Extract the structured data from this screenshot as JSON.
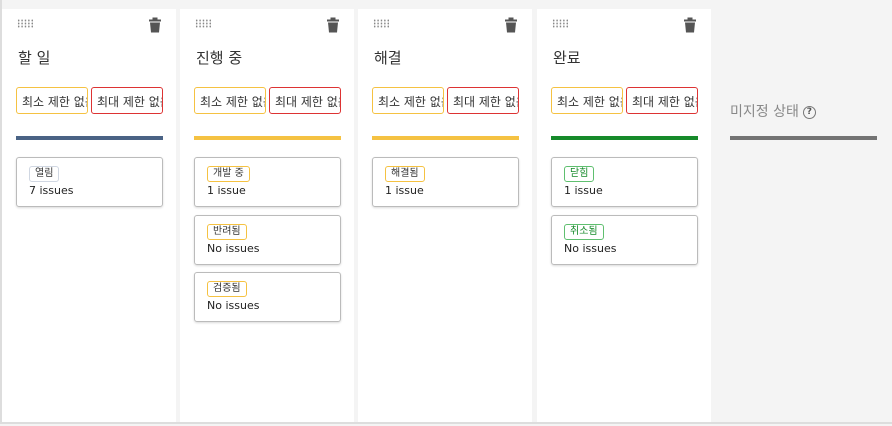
{
  "columns": [
    {
      "title": "할 일",
      "min_label": "최소 제한 없음",
      "max_label": "최대 제한 없음",
      "color": "#4a6385",
      "cards": [
        {
          "badge": "열림",
          "count": "7 issues",
          "badge_color": "#d0d7e2"
        }
      ]
    },
    {
      "title": "진행 중",
      "min_label": "최소 제한 없음",
      "max_label": "최대 제한 없음",
      "color": "#f5c242",
      "cards": [
        {
          "badge": "개발 중",
          "count": "1 issue",
          "badge_color": "#f5c242"
        },
        {
          "badge": "반려됨",
          "count": "No issues",
          "badge_color": "#f5c242"
        },
        {
          "badge": "검증됨",
          "count": "No issues",
          "badge_color": "#f5c242"
        }
      ]
    },
    {
      "title": "해결",
      "min_label": "최소 제한 없음",
      "max_label": "최대 제한 없음",
      "color": "#f5c242",
      "cards": [
        {
          "badge": "해결됨",
          "count": "1 issue",
          "badge_color": "#f5c242"
        }
      ]
    },
    {
      "title": "완료",
      "min_label": "최소 제한 없음",
      "max_label": "최대 제한 없음",
      "color": "#168a2a",
      "cards": [
        {
          "badge": "닫힘",
          "count": "1 issue",
          "badge_color": "#5fbf6f",
          "text_color": "#168a2a"
        },
        {
          "badge": "취소됨",
          "count": "No issues",
          "badge_color": "#5fbf6f",
          "text_color": "#168a2a"
        }
      ]
    }
  ],
  "unset": {
    "label": "미지정 상태",
    "help": "?"
  }
}
